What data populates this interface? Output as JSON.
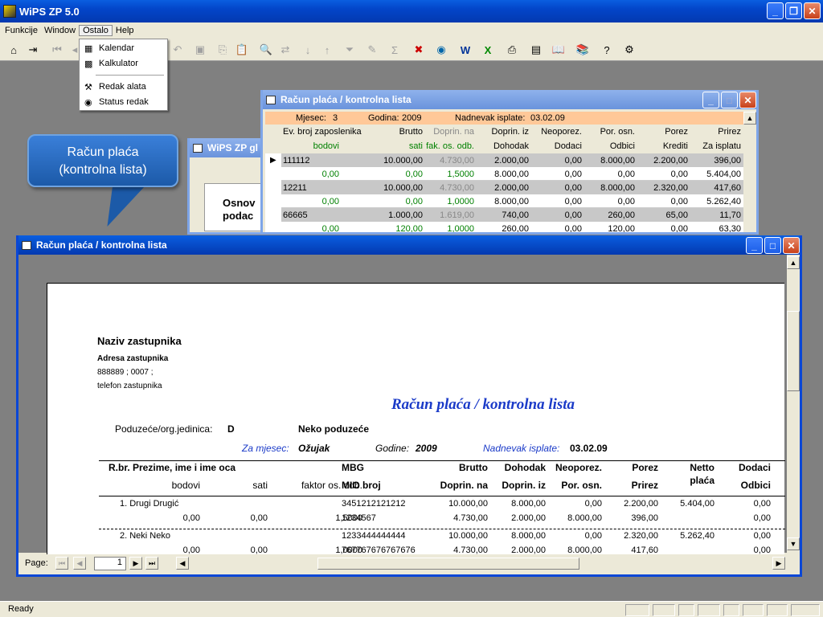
{
  "app": {
    "title": "WiPS ZP 5.0",
    "accent": "#0a5ee0"
  },
  "menu": [
    "Funkcije",
    "Window",
    "Ostalo",
    "Help"
  ],
  "dropdown": [
    {
      "icon": "calendar-icon",
      "label": "Kalendar"
    },
    {
      "icon": "calculator-icon",
      "label": "Kalkulator"
    },
    {
      "icon": "tools-icon",
      "label": "Redak alata"
    },
    {
      "icon": "eye-icon",
      "label": "Status redak"
    }
  ],
  "callout": {
    "line1": "Račun plaća",
    "line2": "(kontrolna lista)"
  },
  "bgwin": {
    "title": "WiPS ZP gl",
    "text1": "Osnov",
    "text2": "podac"
  },
  "gridwin": {
    "title": "Račun plaća / kontrolna lista",
    "mjesec_label": "Mjesec:",
    "mjesec": "3",
    "godina_label": "Godina:",
    "godina": "2009",
    "nadnevak_label": "Nadnevak isplate:",
    "nadnevak": "03.02.09",
    "h1": [
      "Ev. broj zaposlenika",
      "Brutto",
      "Doprin. na",
      "Doprin. iz",
      "Neoporez.",
      "Por. osn.",
      "Porez",
      "Prirez"
    ],
    "h2": [
      "bodovi",
      "sati",
      "fak. os. odb.",
      "Dohodak",
      "Dodaci",
      "Odbici",
      "Krediti",
      "Za isplatu"
    ],
    "rows": [
      {
        "a": [
          "111112",
          "10.000,00",
          "4.730,00",
          "2.000,00",
          "0,00",
          "8.000,00",
          "2.200,00",
          "396,00"
        ],
        "b": [
          "0,00",
          "0,00",
          "1,5000",
          "8.000,00",
          "0,00",
          "0,00",
          "0,00",
          "5.404,00"
        ]
      },
      {
        "a": [
          "12211",
          "10.000,00",
          "4.730,00",
          "2.000,00",
          "0,00",
          "8.000,00",
          "2.320,00",
          "417,60"
        ],
        "b": [
          "0,00",
          "0,00",
          "1,0000",
          "8.000,00",
          "0,00",
          "0,00",
          "0,00",
          "5.262,40"
        ]
      },
      {
        "a": [
          "66665",
          "1.000,00",
          "1.619,00",
          "740,00",
          "0,00",
          "260,00",
          "65,00",
          "11,70"
        ],
        "b": [
          "0,00",
          "120,00",
          "1,0000",
          "260,00",
          "0,00",
          "120,00",
          "0,00",
          "63,30"
        ]
      }
    ]
  },
  "reportwin": {
    "title": "Račun plaća / kontrolna lista",
    "page_label": "Page:",
    "page": "1"
  },
  "report": {
    "agent": "Naziv zastupnika",
    "address": "Adresa zastupnika",
    "codes": "888889 ; 0007 ;",
    "phone": "telefon zastupnika",
    "heading": "Račun plaća / kontrolna lista",
    "org_label": "Poduzeće/org.jedinica:",
    "org_code": "D",
    "org_name": "Neko poduzeće",
    "month_label": "Za mjesec:",
    "month": "Ožujak",
    "year_label": "Godine:",
    "year": "2009",
    "date_label": "Nadnevak isplate:",
    "date": "03.02.09",
    "cols1": [
      "R.br. Prezime, ime i ime oca",
      "MBG",
      "Brutto",
      "Dohodak",
      "Neoporez.",
      "Porez",
      "Netto",
      "Dodaci"
    ],
    "cols1b": "plaća",
    "cols2": [
      "bodovi",
      "sati",
      "faktor os. odb.",
      "MIO broj",
      "Doprin. na",
      "Doprin. iz",
      "Por. osn.",
      "Prirez",
      "Odbici"
    ],
    "rows": [
      {
        "a": [
          "1.  Drugi  Drugić",
          "3451212121212",
          "10.000,00",
          "8.000,00",
          "0,00",
          "2.200,00",
          "5.404,00",
          "0,00"
        ],
        "b": [
          "0,00",
          "0,00",
          "1,5000",
          "1234567",
          "4.730,00",
          "2.000,00",
          "8.000,00",
          "396,00",
          "0,00"
        ]
      },
      {
        "a": [
          "2.  Neki  Neko",
          "1233444444444",
          "10.000,00",
          "8.000,00",
          "0,00",
          "2.320,00",
          "5.262,40",
          "0,00"
        ],
        "b": [
          "0,00",
          "0,00",
          "1,0000",
          "767767676767676",
          "4.730,00",
          "2.000,00",
          "8.000,00",
          "417,60",
          "0,00"
        ]
      }
    ]
  },
  "status": {
    "text": "Ready"
  }
}
